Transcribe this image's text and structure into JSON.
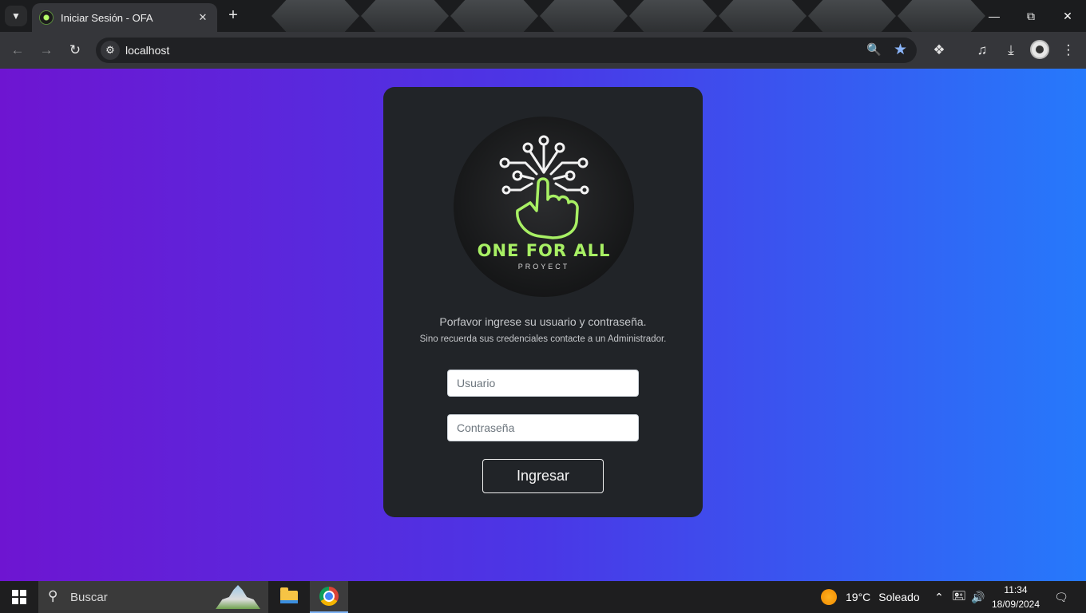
{
  "browser": {
    "tab_title": "Iniciar Sesión - OFA",
    "url": "localhost",
    "new_tab_symbol": "+",
    "tab_close_symbol": "✕"
  },
  "login": {
    "logo_text": "ONE FOR ALL",
    "logo_subtext": "PROYECT",
    "message": "Porfavor ingrese su usuario y contraseña.",
    "submessage": "Sino recuerda sus credenciales contacte a un Administrador.",
    "username_placeholder": "Usuario",
    "password_placeholder": "Contraseña",
    "submit_label": "Ingresar"
  },
  "taskbar": {
    "search_label": "Buscar",
    "weather_temp": "19°C",
    "weather_text": "Soleado",
    "time": "11:34",
    "date": "18/09/2024"
  },
  "colors": {
    "page_gradient_start": "#6e15d1",
    "page_gradient_end": "#2679fb",
    "card_bg": "#212428",
    "logo_accent": "#a8f064"
  }
}
